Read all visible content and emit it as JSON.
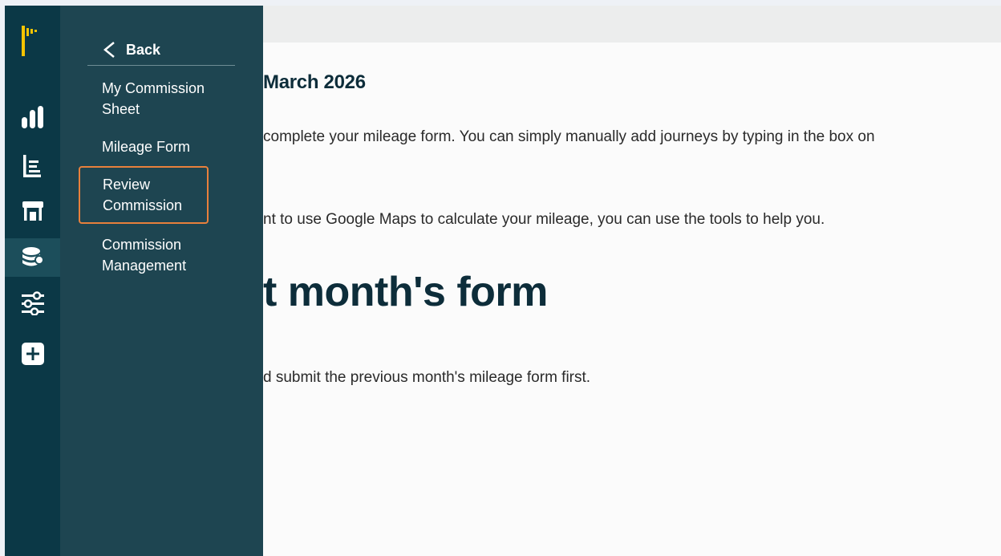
{
  "rail": {
    "icons": [
      "chart-icon",
      "list-icon",
      "store-icon",
      "coins-icon",
      "sliders-icon",
      "plus-icon"
    ],
    "active": "coins-icon",
    "brand_color": "#f5c400"
  },
  "panel": {
    "back_label": "Back",
    "items": [
      {
        "label_line1": "My Commission",
        "label_line2": "Sheet"
      },
      {
        "label_line1": "Mileage Form",
        "label_line2": ""
      },
      {
        "label_line1": "Review",
        "label_line2": "Commission"
      },
      {
        "label_line1": "Commission",
        "label_line2": "Management"
      }
    ],
    "highlight_color": "#e8803c"
  },
  "main": {
    "month_heading": "March 2026",
    "para1": "complete your mileage form. You can simply manually add journeys by typing in the box on",
    "para2": "nt to use Google Maps to calculate your mileage, you can use the tools to help you.",
    "big_heading": "t month's form",
    "para3": "d submit the previous month's mileage form first."
  }
}
